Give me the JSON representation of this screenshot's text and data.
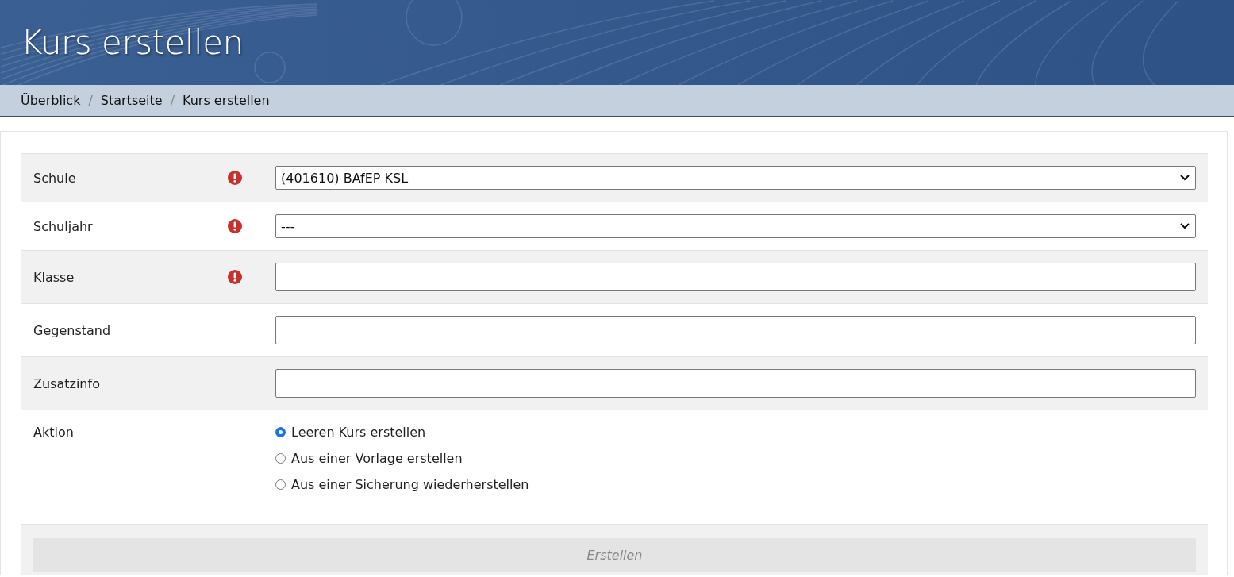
{
  "header": {
    "title": "Kurs erstellen"
  },
  "breadcrumb": [
    {
      "label": "Überblick"
    },
    {
      "separator": "/",
      "label": "Startseite"
    },
    {
      "separator": "/",
      "label": "Kurs erstellen"
    }
  ],
  "form": {
    "rows": [
      {
        "kind": "select",
        "label": "Schule",
        "required": true,
        "value": "(401610) BAfEP KSL"
      },
      {
        "kind": "select",
        "label": "Schuljahr",
        "required": true,
        "value": "---"
      },
      {
        "kind": "text",
        "label": "Klasse",
        "required": true,
        "value": ""
      },
      {
        "kind": "text",
        "label": "Gegenstand",
        "required": false,
        "value": ""
      },
      {
        "kind": "text",
        "label": "Zusatzinfo",
        "required": false,
        "value": ""
      },
      {
        "kind": "radio",
        "label": "Aktion",
        "required": false,
        "options": [
          {
            "label": "Leeren Kurs erstellen",
            "selected": true
          },
          {
            "label": "Aus einer Vorlage erstellen",
            "selected": false
          },
          {
            "label": "Aus einer Sicherung wiederherstellen",
            "selected": false
          }
        ]
      }
    ],
    "submit": {
      "label": "Erstellen",
      "disabled": true
    }
  }
}
